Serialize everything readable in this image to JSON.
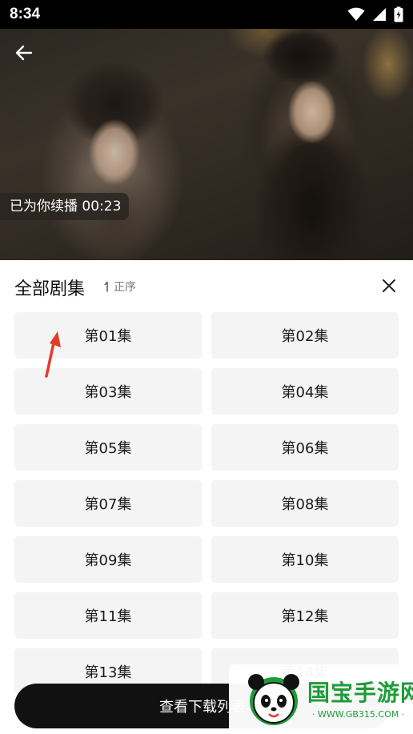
{
  "status_bar": {
    "time": "8:34"
  },
  "player": {
    "resume_label": "已为你续播 00:23"
  },
  "episode_sheet": {
    "title": "全部剧集",
    "sort_label": "正序",
    "episodes": [
      "第01集",
      "第02集",
      "第03集",
      "第04集",
      "第05集",
      "第06集",
      "第07集",
      "第08集",
      "第09集",
      "第10集",
      "第11集",
      "第12集",
      "第13集",
      "第14集"
    ]
  },
  "download_button": {
    "label": "查看下载列表"
  },
  "watermark": {
    "brand": "国宝手游网",
    "url": "· WWW.GB315.COM ·"
  },
  "colors": {
    "accent_annotation": "#e23b2e",
    "watermark_green": "#1f9b3a",
    "button_dark": "#111111"
  }
}
